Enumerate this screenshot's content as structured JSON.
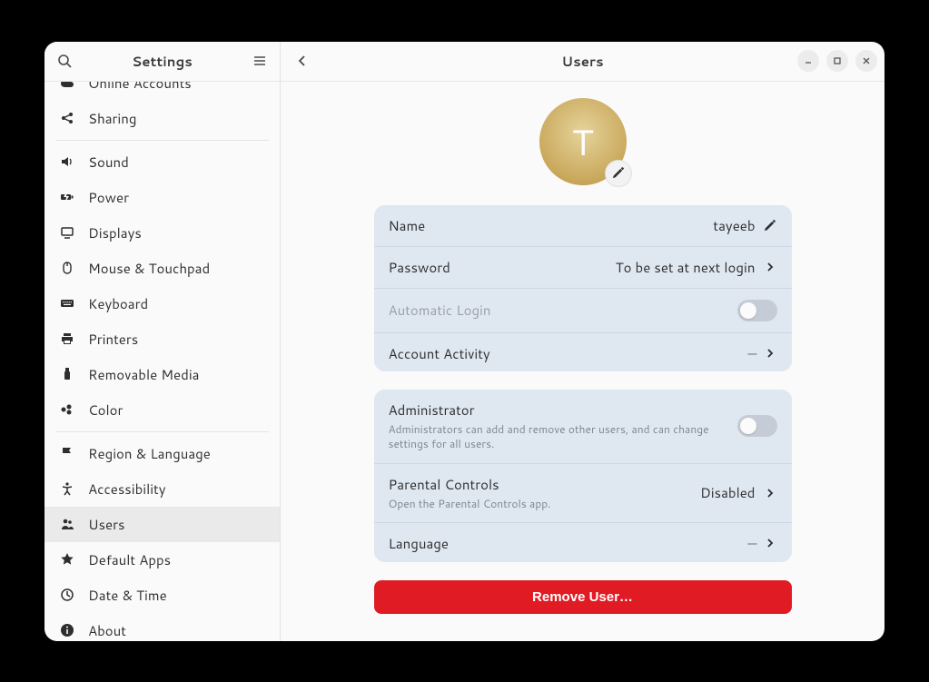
{
  "sidebar": {
    "title": "Settings",
    "items": [
      {
        "label": "Online Accounts"
      },
      {
        "label": "Sharing"
      },
      {
        "label": "Sound"
      },
      {
        "label": "Power"
      },
      {
        "label": "Displays"
      },
      {
        "label": "Mouse & Touchpad"
      },
      {
        "label": "Keyboard"
      },
      {
        "label": "Printers"
      },
      {
        "label": "Removable Media"
      },
      {
        "label": "Color"
      },
      {
        "label": "Region & Language"
      },
      {
        "label": "Accessibility"
      },
      {
        "label": "Users"
      },
      {
        "label": "Default Apps"
      },
      {
        "label": "Date & Time"
      },
      {
        "label": "About"
      }
    ]
  },
  "main": {
    "title": "Users",
    "avatar_initial": "T",
    "rows": {
      "name_label": "Name",
      "name_value": "tayeeb",
      "password_label": "Password",
      "password_value": "To be set at next login",
      "autologin_label": "Automatic Login",
      "activity_label": "Account Activity",
      "activity_value": "—",
      "admin_label": "Administrator",
      "admin_sub": "Administrators can add and remove other users, and can change settings for all users.",
      "parental_label": "Parental Controls",
      "parental_sub": "Open the Parental Controls app.",
      "parental_value": "Disabled",
      "language_label": "Language",
      "language_value": "—"
    },
    "remove_label": "Remove User…"
  }
}
